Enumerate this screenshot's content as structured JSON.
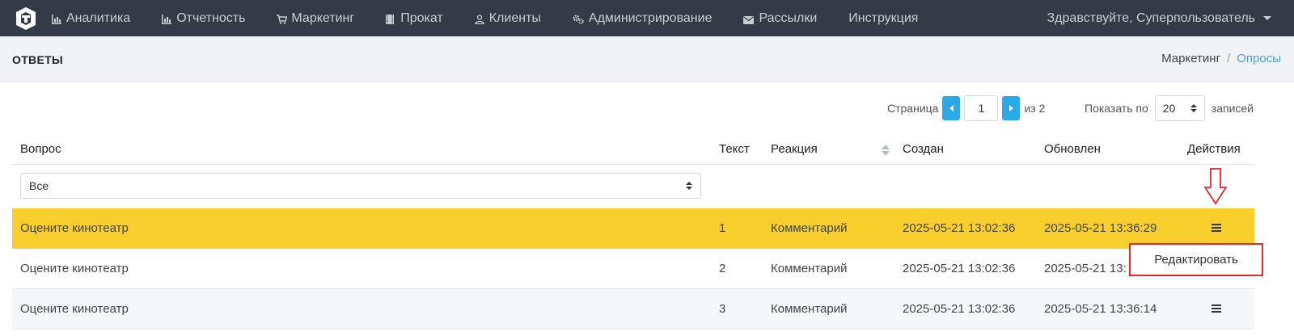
{
  "nav": {
    "items": [
      {
        "label": "Аналитика",
        "icon": "bar-chart-icon"
      },
      {
        "label": "Отчетность",
        "icon": "bar-chart-icon"
      },
      {
        "label": "Маркетинг",
        "icon": "cart-icon"
      },
      {
        "label": "Прокат",
        "icon": "film-icon"
      },
      {
        "label": "Клиенты",
        "icon": "user-icon"
      },
      {
        "label": "Администрирование",
        "icon": "gears-icon"
      },
      {
        "label": "Рассылки",
        "icon": "envelope-icon"
      },
      {
        "label": "Инструкция",
        "icon": ""
      }
    ],
    "user_greeting": "Здравствуйте, Суперпользователь"
  },
  "header": {
    "title": "ОТВЕТЫ",
    "breadcrumb": [
      "Маркетинг",
      "Опросы"
    ],
    "breadcrumb_sep": "/"
  },
  "pager": {
    "page_label": "Страница",
    "page_value": "1",
    "total_label": "из 2",
    "show_label": "Показать по",
    "page_size": "20",
    "records_label": "записей"
  },
  "table": {
    "columns": [
      "Вопрос",
      "Текст",
      "Реакция",
      "Создан",
      "Обновлен",
      "Действия"
    ],
    "filter_value": "Все",
    "rows": [
      {
        "question": "Оцените кинотеатр",
        "text": "1",
        "reaction": "Комментарий",
        "created": "2025-05-21 13:02:36",
        "updated": "2025-05-21 13:36:29"
      },
      {
        "question": "Оцените кинотеатр",
        "text": "2",
        "reaction": "Комментарий",
        "created": "2025-05-21 13:02:36",
        "updated": "2025-05-21 13:"
      },
      {
        "question": "Оцените кинотеатр",
        "text": "3",
        "reaction": "Комментарий",
        "created": "2025-05-21 13:02:36",
        "updated": "2025-05-21 13:36:14"
      }
    ]
  },
  "dropdown": {
    "edit_label": "Редактировать"
  },
  "colors": {
    "navbar": "#343a46",
    "highlight": "#f8cf2c",
    "accent": "#29a9e8",
    "annotation": "#e8262a"
  }
}
